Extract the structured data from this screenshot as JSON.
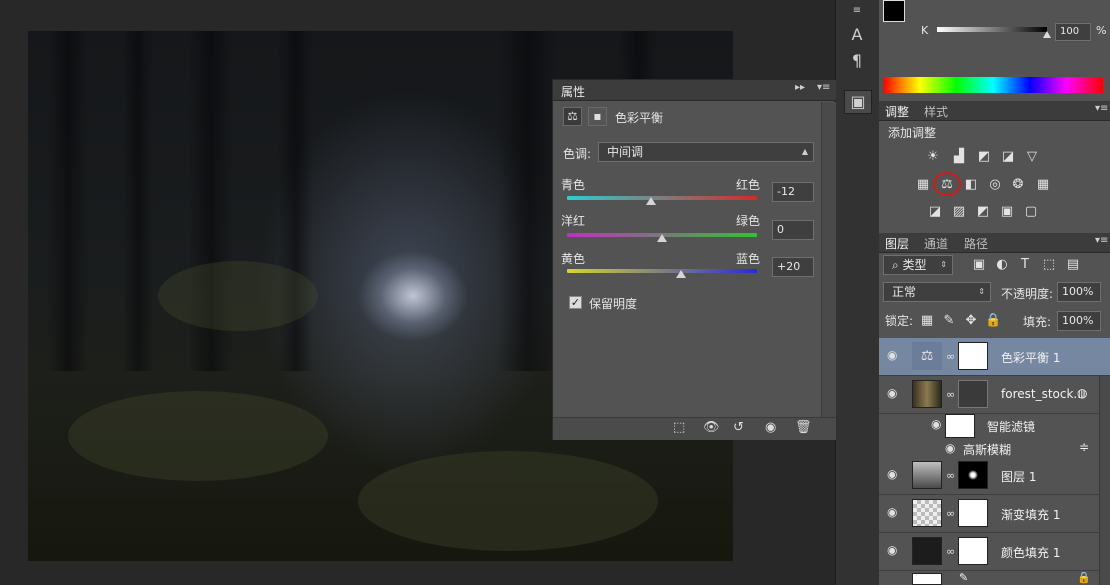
{
  "properties_panel": {
    "tab": "属性",
    "title": "色彩平衡",
    "tone_label": "色调:",
    "tone_value": "中间调",
    "sliders": [
      {
        "left": "青色",
        "right": "红色",
        "value": "-12",
        "fraction": 0.44
      },
      {
        "left": "洋红",
        "right": "绿色",
        "value": "0",
        "fraction": 0.5
      },
      {
        "left": "黄色",
        "right": "蓝色",
        "value": "+20",
        "fraction": 0.6
      }
    ],
    "preserve_label": "保留明度",
    "preserve_checked": true
  },
  "color_panel": {
    "channel_label": "K",
    "value": "100",
    "unit": "%"
  },
  "adjustments_panel": {
    "tabs": [
      "调整",
      "样式"
    ],
    "heading": "添加调整"
  },
  "layers_panel": {
    "tabs": [
      "图层",
      "通道",
      "路径"
    ],
    "filter_label": "类型",
    "blend_mode": "正常",
    "opacity_label": "不透明度:",
    "opacity_value": "100%",
    "lock_label": "锁定:",
    "fill_label": "填充:",
    "fill_value": "100%",
    "layers": [
      {
        "name": "色彩平衡 1"
      },
      {
        "name": "forest_stock..."
      },
      {
        "name": "智能滤镜"
      },
      {
        "name": "高斯模糊"
      },
      {
        "name": "图层 1"
      },
      {
        "name": "渐变填充 1"
      },
      {
        "name": "颜色填充 1"
      }
    ]
  }
}
